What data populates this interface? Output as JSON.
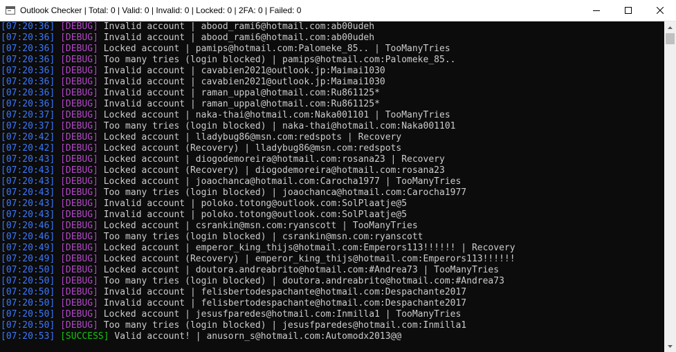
{
  "window": {
    "title": "Outlook Checker | Total: 0 | Valid: 0 | Invalid: 0 | Locked: 0 | 2FA: 0 | Failed: 0"
  },
  "colors": {
    "timestamp": "#3b78ff",
    "debug": "#b148c6",
    "success": "#16c60c",
    "text": "#cccccc",
    "background": "#0c0c0c"
  },
  "log": [
    {
      "time": "[07:20:36]",
      "level": "[DEBUG]",
      "type": "debug",
      "message": "Invalid account | abood_rami6@hotmail.com:ab00udeh"
    },
    {
      "time": "[07:20:36]",
      "level": "[DEBUG]",
      "type": "debug",
      "message": "Invalid account | abood_rami6@hotmail.com:ab00udeh"
    },
    {
      "time": "[07:20:36]",
      "level": "[DEBUG]",
      "type": "debug",
      "message": "Locked account | pamips@hotmail.com:Palomeke_85.. | TooManyTries"
    },
    {
      "time": "[07:20:36]",
      "level": "[DEBUG]",
      "type": "debug",
      "message": "Too many tries (login blocked) | pamips@hotmail.com:Palomeke_85.."
    },
    {
      "time": "[07:20:36]",
      "level": "[DEBUG]",
      "type": "debug",
      "message": "Invalid account | cavabien2021@outlook.jp:Maimai1030"
    },
    {
      "time": "[07:20:36]",
      "level": "[DEBUG]",
      "type": "debug",
      "message": "Invalid account | cavabien2021@outlook.jp:Maimai1030"
    },
    {
      "time": "[07:20:36]",
      "level": "[DEBUG]",
      "type": "debug",
      "message": "Invalid account | raman_uppal@hotmail.com:Ru861125*"
    },
    {
      "time": "[07:20:36]",
      "level": "[DEBUG]",
      "type": "debug",
      "message": "Invalid account | raman_uppal@hotmail.com:Ru861125*"
    },
    {
      "time": "[07:20:37]",
      "level": "[DEBUG]",
      "type": "debug",
      "message": "Locked account | naka-thai@hotmail.com:Naka001101 | TooManyTries"
    },
    {
      "time": "[07:20:37]",
      "level": "[DEBUG]",
      "type": "debug",
      "message": "Too many tries (login blocked) | naka-thai@hotmail.com:Naka001101"
    },
    {
      "time": "[07:20:42]",
      "level": "[DEBUG]",
      "type": "debug",
      "message": "Locked account | lladybug86@msn.com:redspots | Recovery"
    },
    {
      "time": "[07:20:42]",
      "level": "[DEBUG]",
      "type": "debug",
      "message": "Locked account (Recovery) | lladybug86@msn.com:redspots"
    },
    {
      "time": "[07:20:43]",
      "level": "[DEBUG]",
      "type": "debug",
      "message": "Locked account | diogodemoreira@hotmail.com:rosana23 | Recovery"
    },
    {
      "time": "[07:20:43]",
      "level": "[DEBUG]",
      "type": "debug",
      "message": "Locked account (Recovery) | diogodemoreira@hotmail.com:rosana23"
    },
    {
      "time": "[07:20:43]",
      "level": "[DEBUG]",
      "type": "debug",
      "message": "Locked account | joaochanca@hotmail.com:Carocha1977 | TooManyTries"
    },
    {
      "time": "[07:20:43]",
      "level": "[DEBUG]",
      "type": "debug",
      "message": "Too many tries (login blocked) | joaochanca@hotmail.com:Carocha1977"
    },
    {
      "time": "[07:20:43]",
      "level": "[DEBUG]",
      "type": "debug",
      "message": "Invalid account | poloko.totong@outlook.com:SolPlaatje@5"
    },
    {
      "time": "[07:20:43]",
      "level": "[DEBUG]",
      "type": "debug",
      "message": "Invalid account | poloko.totong@outlook.com:SolPlaatje@5"
    },
    {
      "time": "[07:20:46]",
      "level": "[DEBUG]",
      "type": "debug",
      "message": "Locked account | csrankin@msn.com:ryanscott | TooManyTries"
    },
    {
      "time": "[07:20:46]",
      "level": "[DEBUG]",
      "type": "debug",
      "message": "Too many tries (login blocked) | csrankin@msn.com:ryanscott"
    },
    {
      "time": "[07:20:49]",
      "level": "[DEBUG]",
      "type": "debug",
      "message": "Locked account | emperor_king_thijs@hotmail.com:Emperors113!!!!!! | Recovery"
    },
    {
      "time": "[07:20:49]",
      "level": "[DEBUG]",
      "type": "debug",
      "message": "Locked account (Recovery) | emperor_king_thijs@hotmail.com:Emperors113!!!!!!"
    },
    {
      "time": "[07:20:50]",
      "level": "[DEBUG]",
      "type": "debug",
      "message": "Locked account | doutora.andreabrito@hotmail.com:#Andrea73 | TooManyTries"
    },
    {
      "time": "[07:20:50]",
      "level": "[DEBUG]",
      "type": "debug",
      "message": "Too many tries (login blocked) | doutora.andreabrito@hotmail.com:#Andrea73"
    },
    {
      "time": "[07:20:50]",
      "level": "[DEBUG]",
      "type": "debug",
      "message": "Invalid account | felisbertodespachante@hotmail.com:Despachante2017"
    },
    {
      "time": "[07:20:50]",
      "level": "[DEBUG]",
      "type": "debug",
      "message": "Invalid account | felisbertodespachante@hotmail.com:Despachante2017"
    },
    {
      "time": "[07:20:50]",
      "level": "[DEBUG]",
      "type": "debug",
      "message": "Locked account | jesusfparedes@hotmail.com:Inmilla1 | TooManyTries"
    },
    {
      "time": "[07:20:50]",
      "level": "[DEBUG]",
      "type": "debug",
      "message": "Too many tries (login blocked) | jesusfparedes@hotmail.com:Inmilla1"
    },
    {
      "time": "[07:20:53]",
      "level": "[SUCCESS]",
      "type": "success",
      "message": "Valid account! | anusorn_s@hotmail.com:Automodx2013@@"
    }
  ]
}
